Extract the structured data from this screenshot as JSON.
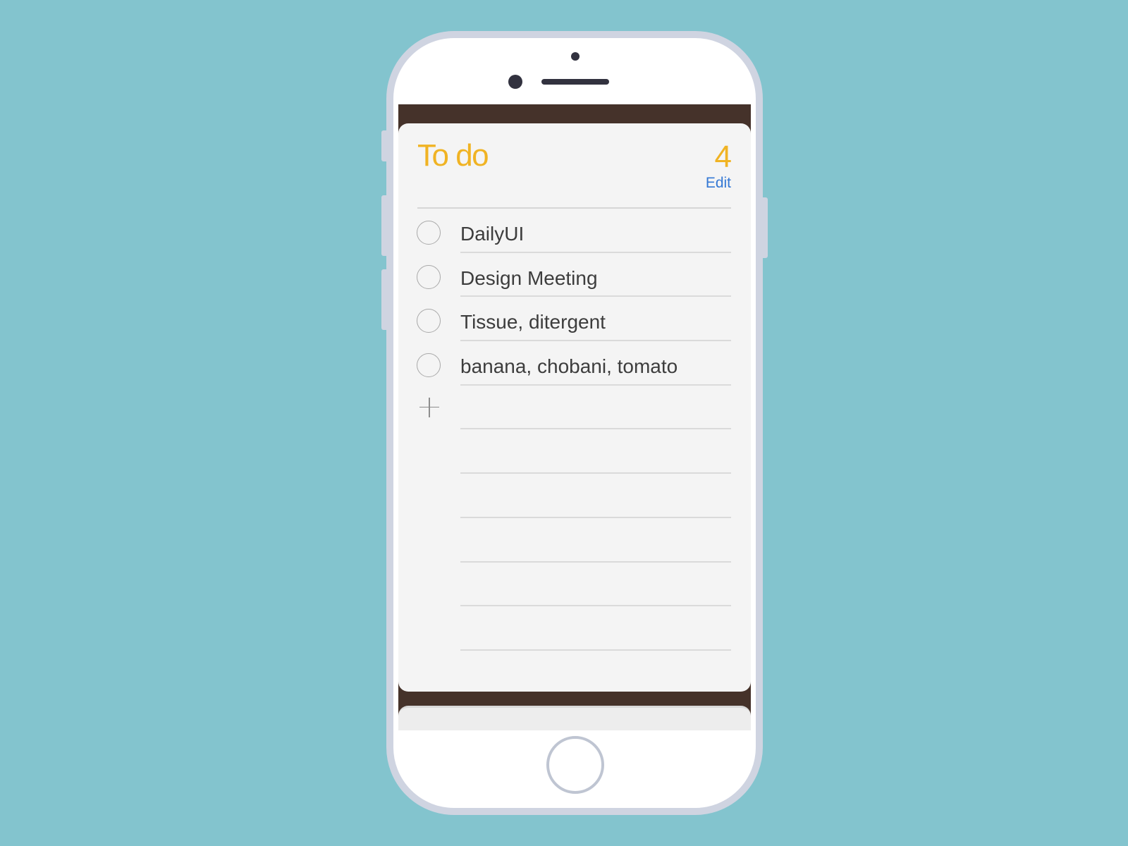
{
  "list": {
    "title": "To do",
    "count": "4",
    "edit_label": "Edit",
    "accent_color": "#f0b323",
    "link_color": "#3478d4"
  },
  "tasks": [
    {
      "label": "DailyUI",
      "completed": false
    },
    {
      "label": "Design Meeting",
      "completed": false
    },
    {
      "label": "Tissue, ditergent",
      "completed": false
    },
    {
      "label": "banana, chobani, tomato",
      "completed": false
    }
  ],
  "icons": {
    "add": "plus-icon",
    "checkbox": "circle-checkbox-icon"
  }
}
